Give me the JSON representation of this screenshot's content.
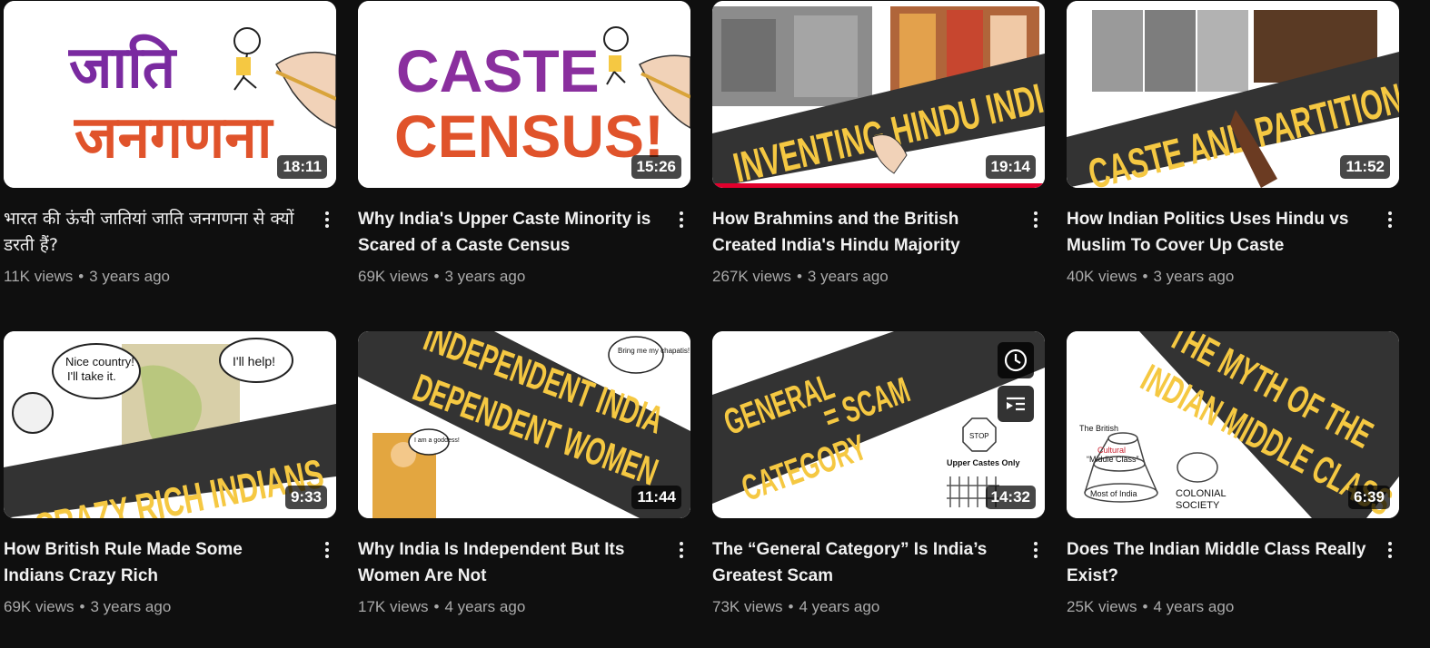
{
  "videos": [
    {
      "title": "भारत की ऊंची जातियां जाति जनगणना से क्यों डरती हैं?",
      "views": "11K views",
      "age": "3 years ago",
      "duration": "18:11",
      "thumb_text": [
        "जाति",
        "जनगणना"
      ]
    },
    {
      "title": "Why India's Upper Caste Minority is Scared of a Caste Census",
      "views": "69K views",
      "age": "3 years ago",
      "duration": "15:26",
      "thumb_text": [
        "CASTE",
        "CENSUS!"
      ]
    },
    {
      "title": "How Brahmins and the British Created India's Hindu Majority",
      "views": "267K views",
      "age": "3 years ago",
      "duration": "19:14",
      "watch_progress": 1.0,
      "thumb_text": [
        "INVENTING HINDU INDIA"
      ]
    },
    {
      "title": "How Indian Politics Uses Hindu vs Muslim To Cover Up Caste",
      "views": "40K views",
      "age": "3 years ago",
      "duration": "11:52",
      "thumb_text": [
        "CASTE AND PARTITION"
      ]
    },
    {
      "title": "How British Rule Made Some Indians Crazy Rich",
      "views": "69K views",
      "age": "3 years ago",
      "duration": "9:33",
      "thumb_text": [
        "CRAZY RICH INDIANS",
        "Nice country!",
        "I'll take it.",
        "I'll help!"
      ]
    },
    {
      "title": "Why India Is Independent But Its Women Are Not",
      "views": "17K views",
      "age": "4 years ago",
      "duration": "11:44",
      "thumb_text": [
        "INDEPENDENT INDIA",
        "DEPENDENT WOMEN",
        "Bring me my chapatis!",
        "I am a goddess!"
      ]
    },
    {
      "title": "The “General Category” Is India’s Greatest Scam",
      "views": "73K views",
      "age": "4 years ago",
      "duration": "14:32",
      "thumb_text": [
        "GENERAL",
        "CATEGORY",
        "= SCAM",
        "STOP",
        "Upper Castes Only"
      ]
    },
    {
      "title": "Does The Indian Middle Class Really Exist?",
      "views": "25K views",
      "age": "4 years ago",
      "duration": "6:39",
      "thumb_text": [
        "THE MYTH OF THE",
        "INDIAN MIDDLE CLASS",
        "The British",
        "Cultural",
        "“Middle Class”",
        "Most of India",
        "COLONIAL",
        "SOCIETY"
      ]
    }
  ],
  "meta_separator": "•",
  "colors": {
    "background": "#0f0f0f",
    "title": "#f1f1f1",
    "meta": "#aaaaaa",
    "banner_dark": "#333333",
    "banner_text": "#f5c842",
    "progress": "#e1002d"
  },
  "icons": [
    "more-vert-icon",
    "watch-later-icon",
    "add-to-queue-icon"
  ]
}
